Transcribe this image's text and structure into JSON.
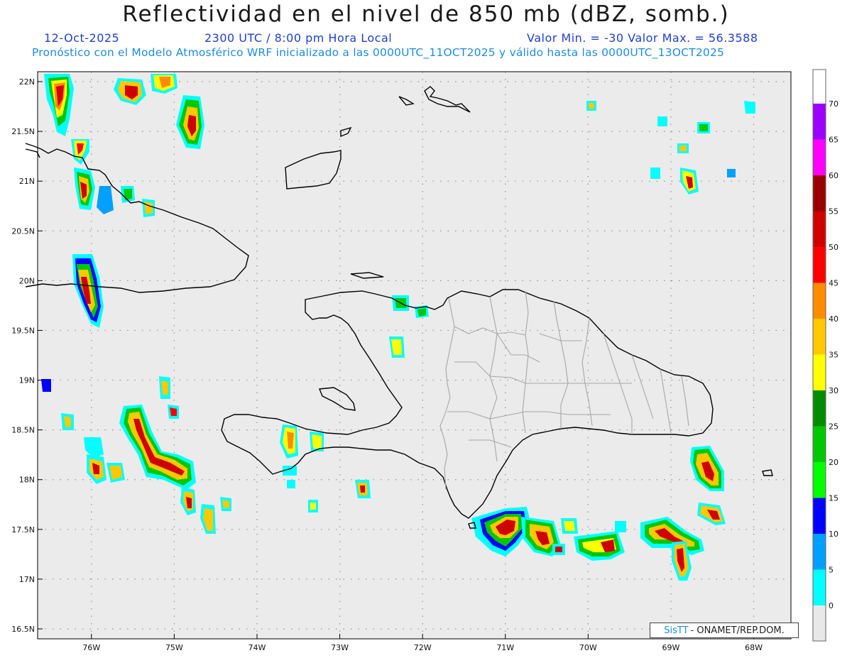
{
  "header": {
    "title": "Reflectividad en el nivel de 850 mb (dBZ, somb.)",
    "date": "12-Oct-2025",
    "time": "2300 UTC / 8:00 pm Hora Local",
    "min_max": "Valor Min. = -30  Valor Max. = 56.3588",
    "model_info": "Pronóstico con el Modelo Atmosférico WRF inicializado a las 0000UTC_11OCT2025 y válido hasta las  0000UTC_13OCT2025"
  },
  "map": {
    "lon_range": [
      -76.65,
      -67.55
    ],
    "lat_range": [
      16.4,
      22.1
    ],
    "lat_labels": [
      "22N",
      "21.5N",
      "21N",
      "20.5N",
      "20N",
      "19.5N",
      "19N",
      "18.5N",
      "18N",
      "17.5N",
      "17N",
      "16.5N"
    ],
    "lon_labels": [
      "76W",
      "75W",
      "74W",
      "73W",
      "72W",
      "71W",
      "70W",
      "69W",
      "68W"
    ],
    "colors": {
      "ocean": "#ebebeb",
      "coast": "#000000",
      "provinces": "#a6a6a6",
      "grid": "#909090"
    }
  },
  "colorbar": {
    "labels": [
      "0",
      "5",
      "10",
      "15",
      "20",
      "25",
      "30",
      "35",
      "40",
      "45",
      "50",
      "55",
      "60",
      "65",
      "70"
    ],
    "colors": [
      "#00ffff",
      "#00a0ff",
      "#0000ff",
      "#00ff00",
      "#00c800",
      "#008c00",
      "#ffff00",
      "#ffc800",
      "#ff8c00",
      "#ff0000",
      "#d00000",
      "#9a0000",
      "#ff00ff",
      "#9c00ff"
    ],
    "extension_color": "#e8e8e8",
    "top_color": "#ffffff"
  },
  "credit": {
    "brand": "SisTT",
    "text": "- ONAMET/REP.DOM."
  }
}
